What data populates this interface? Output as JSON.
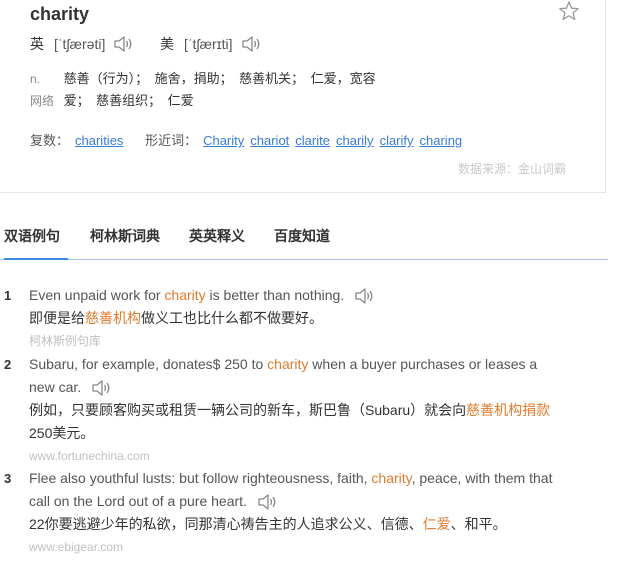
{
  "word": "charity",
  "pron": [
    {
      "label": "英",
      "ipa": "[ˈtʃærəti]"
    },
    {
      "label": "美",
      "ipa": "[ˈtʃærɪti]"
    }
  ],
  "defs": [
    {
      "pos": "n.",
      "text": "慈善（行为）；　施舍，捐助；　慈善机关；　仁爱，宽容"
    },
    {
      "pos": "网络",
      "text": "爱；　慈善组织；　仁爱"
    }
  ],
  "forms": {
    "plural_label": "复数：",
    "plural": "charities",
    "similar_label": "形近词：",
    "similar": [
      "Charity",
      "chariot",
      "clarite",
      "charily",
      "clarify",
      "charing"
    ]
  },
  "source": "数据来源：金山词霸",
  "tabs": [
    "双语例句",
    "柯林斯词典",
    "英英释义",
    "百度知道"
  ],
  "sentences": [
    {
      "num": "1",
      "en_pre": "Even unpaid work for ",
      "en_hl": "charity",
      "en_post": " is better than nothing.",
      "cn_pre": "即便是给",
      "cn_hl": "慈善机构",
      "cn_post": "做义工也比什么都不做要好。",
      "src": "柯林斯例句库"
    },
    {
      "num": "2",
      "en_pre": "Subaru, for example, donates$ 250 to ",
      "en_hl": "charity",
      "en_post": " when a buyer purchases or leases a new car.",
      "cn_pre": "例如，只要顾客购买或租赁一辆公司的新车，斯巴鲁（Subaru）就会向",
      "cn_hl": "慈善机构捐款",
      "cn_post": "250美元。",
      "src": "www.fortunechina.com"
    },
    {
      "num": "3",
      "en_pre": "Flee also youthful lusts: but follow righteousness, faith, ",
      "en_hl": "charity",
      "en_post": ", peace, with them that call on the Lord out of a pure heart.",
      "cn_pre": "22你要逃避少年的私欲，同那清心祷告主的人追求公义、信德、",
      "cn_hl": "仁爱",
      "cn_post": "、和平。",
      "src": "www.ebigear.com"
    }
  ]
}
